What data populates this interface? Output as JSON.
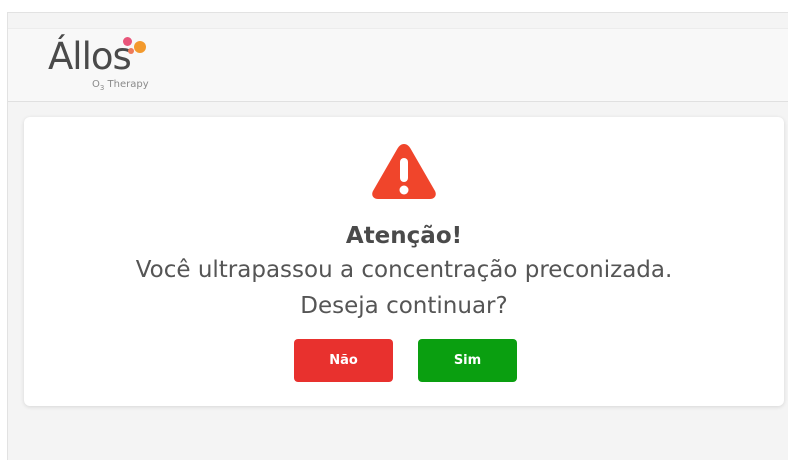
{
  "header": {
    "logo_text": "Állos",
    "logo_sub_prefix": "O",
    "logo_sub_index": "3",
    "logo_sub_suffix": " Therapy"
  },
  "dialog": {
    "title": "Atenção!",
    "message_line1": "Você ultrapassou a concentração preconizada.",
    "message_line2": "Deseja continuar?",
    "no_label": "Não",
    "yes_label": "Sim"
  },
  "colors": {
    "warning": "#f0452b",
    "no_button": "#e8312e",
    "yes_button": "#0a9f10",
    "logo_dot_pink": "#e8557a",
    "logo_dot_orange": "#f39a2d"
  },
  "icons": {
    "warning": "warning-triangle-icon"
  }
}
